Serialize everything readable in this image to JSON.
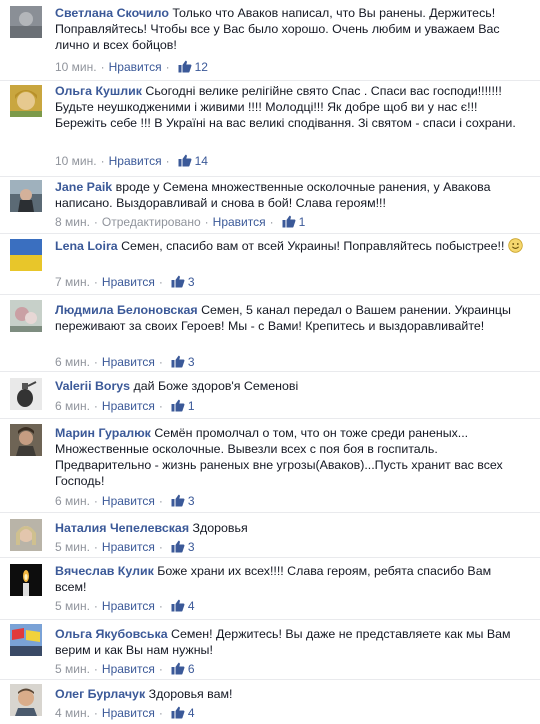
{
  "like_label": "Нравится",
  "edited_label": "Отредактировано",
  "comments": [
    {
      "author": "Светлана Скочило",
      "text": "Только что Аваков написал, что Вы ранены. Держитесь! Поправляйтесь! Чтобы все у Вас было хорошо. Очень любим и уважаем Вас лично и всех бойцов!",
      "time": "10 мин.",
      "likes": "12",
      "avatar": "photo-gray"
    },
    {
      "author": "Ольга Кушлик",
      "text": "Сьогодні велике релігійне свято Спас . Спаси вас господи!!!!!!! Будьте неушкодженими і живими !!!! Молодці!!! Як добре щоб ви у нас є!!! Бережіть себе !!! В Україні на вас великі сподівання. Зі святом - спаси і сохрани.",
      "time": "10 мин.",
      "likes": "14",
      "avatar": "photo-blonde"
    },
    {
      "author": "Jane Paik",
      "text": "вроде у Семена множественные осколочные ранения, у Авакова написано. Выздоравливай и снова в бой! Слава героям!!!",
      "time": "8 мин.",
      "edited": true,
      "likes": "1",
      "avatar": "photo-dark"
    },
    {
      "author": "Lena Loira",
      "text": "Семен, спасибо вам от всей Украины! Поправляйтесь побыстрее!!",
      "emoji": "smile",
      "time": "7 мин.",
      "likes": "3",
      "avatar": "flag-ukraine"
    },
    {
      "author": "Людмила Белоновская",
      "text": "Семен, 5 канал передал о Вашем ранении. Украинцы переживают за своих Героев! Мы - с Вами! Крепитесь и выздоравливайте!",
      "time": "6 мин.",
      "likes": "3",
      "avatar": "photo-rose"
    },
    {
      "author": "Valerii Borys",
      "text": "дай Боже здоров'я Семенові",
      "time": "6 мин.",
      "likes": "1",
      "avatar": "photo-grenade"
    },
    {
      "author": "Марин Гуралюк",
      "text": "Семён промолчал о том, что он тоже среди раненых... Множественные осколочные. Вывезли всех с поя боя в госпиталь. Предварительно - жизнь раненых вне угрозы(Аваков)...Пусть хранит вас всех Господь!",
      "time": "6 мин.",
      "likes": "3",
      "avatar": "photo-man"
    },
    {
      "author": "Наталия Чепелевская",
      "text": "Здоровья",
      "time": "5 мин.",
      "likes": "3",
      "avatar": "photo-woman"
    },
    {
      "author": "Вячеслав Кулик",
      "text": "Боже храни их всех!!!! Слава героям, ребята спасибо Вам всем!",
      "time": "5 мин.",
      "likes": "4",
      "avatar": "photo-candle"
    },
    {
      "author": "Ольга Якубовська",
      "text": "Семен! Держитесь! Вы даже не представляете как мы Вам верим и как Вы нам нужны!",
      "time": "5 мин.",
      "likes": "6",
      "avatar": "photo-flags"
    },
    {
      "author": "Олег Бурлачук",
      "text": "Здоровья вам!",
      "time": "4 мин.",
      "likes": "4",
      "avatar": "photo-man2"
    }
  ],
  "colors": {
    "link": "#3b5998",
    "meta": "#90949c",
    "text": "#141823"
  }
}
